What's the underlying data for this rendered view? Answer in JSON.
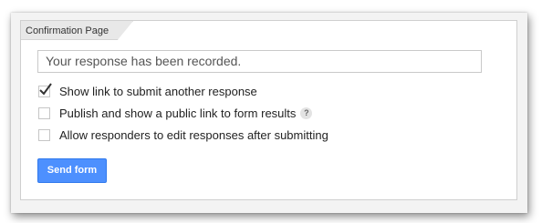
{
  "panel": {
    "tab_title": "Confirmation Page"
  },
  "confirmation": {
    "message_value": "Your response has been recorded."
  },
  "options": [
    {
      "label": "Show link to submit another response",
      "checked": true
    },
    {
      "label": "Publish and show a public link to form results",
      "checked": false,
      "help_icon": "question-icon"
    },
    {
      "label": "Allow responders to edit responses after submitting",
      "checked": false
    }
  ],
  "actions": {
    "send_label": "Send form"
  },
  "colors": {
    "accent": "#4d90fe",
    "accent_border": "#3079ed"
  }
}
